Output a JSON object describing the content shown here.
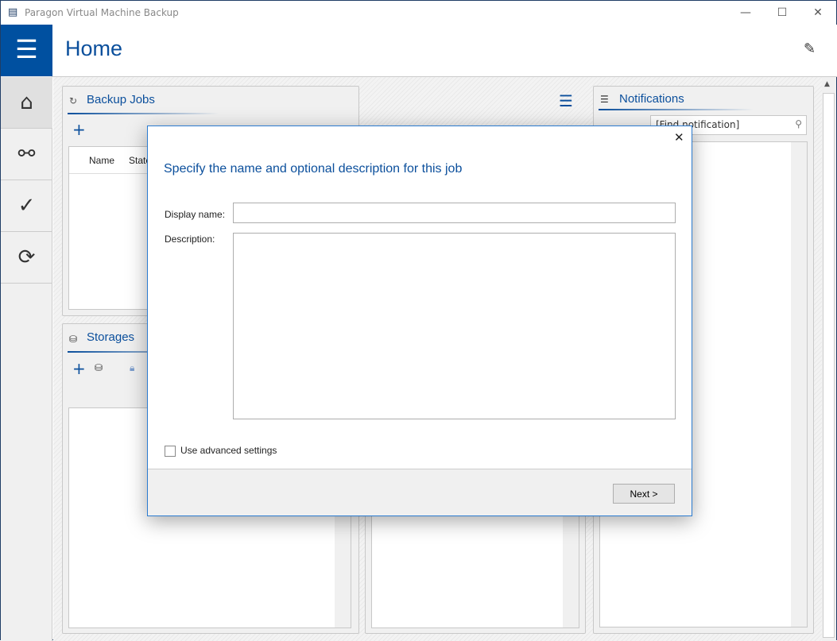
{
  "window": {
    "title": "Paragon Virtual Machine Backup",
    "minimize": "—",
    "maximize": "☐",
    "close": "✕"
  },
  "header": {
    "title": "Home"
  },
  "panels": {
    "backup_jobs": {
      "title": "Backup Jobs",
      "columns": [
        "Name",
        "State"
      ]
    },
    "storages": {
      "title": "Storages"
    },
    "notifications": {
      "title": "Notifications",
      "search_placeholder": "[Find notification]"
    }
  },
  "dialog": {
    "heading": "Specify the name and optional description for this job",
    "display_name_label": "Display name:",
    "display_name_value": "",
    "description_label": "Description:",
    "description_value": "",
    "advanced_label": "Use advanced settings",
    "advanced_checked": false,
    "next_label": "Next >",
    "close": "✕"
  }
}
